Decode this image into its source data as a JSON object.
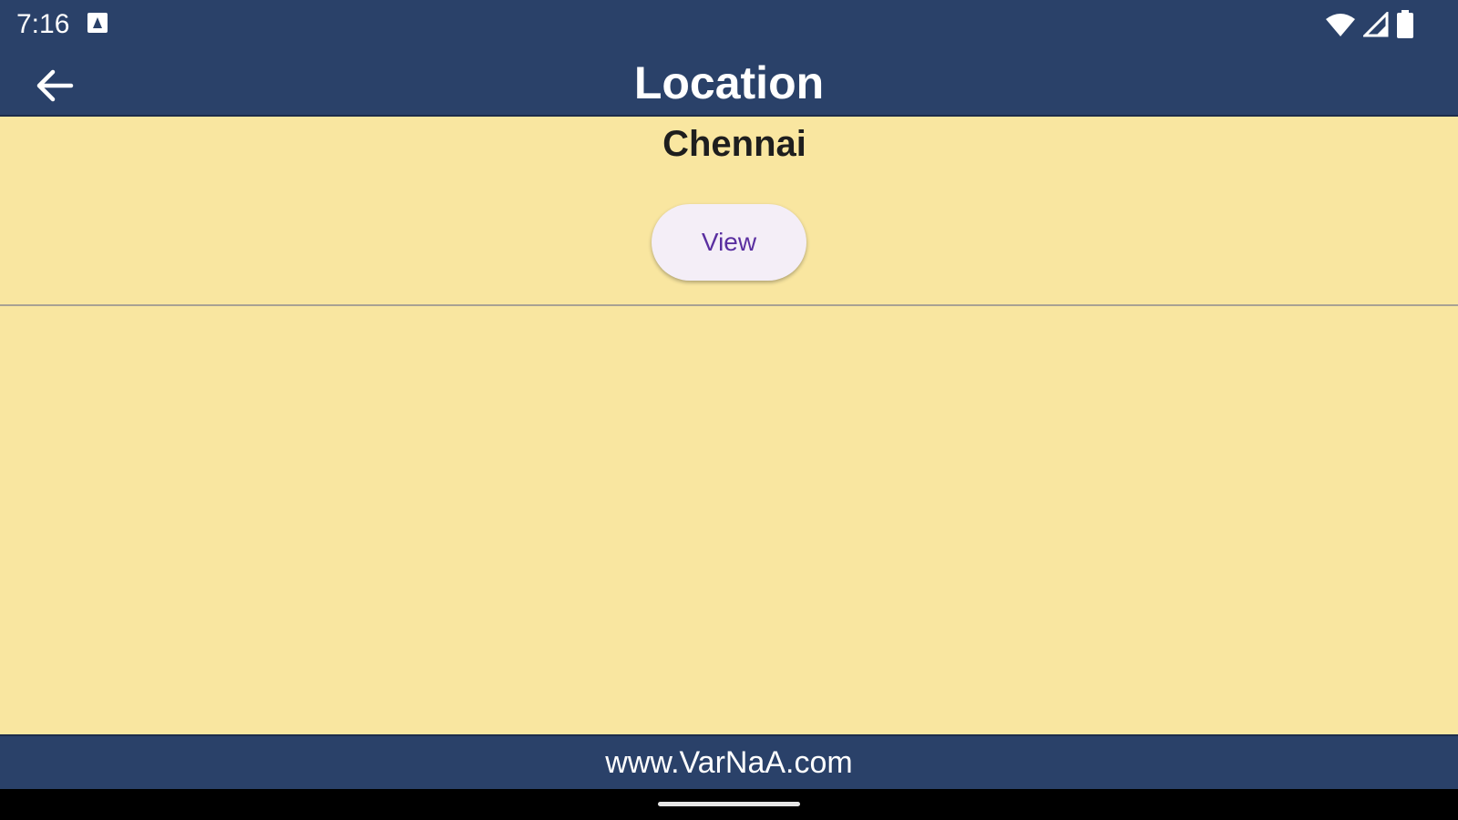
{
  "status_bar": {
    "time": "7:16",
    "icons": [
      "notification-icon",
      "wifi-icon",
      "signal-icon",
      "battery-icon"
    ]
  },
  "app_bar": {
    "title": "Location",
    "back_icon": "arrow-back-icon"
  },
  "content": {
    "city": "Chennai",
    "view_button_label": "View"
  },
  "footer": {
    "link_text": "www.VarNaA.com"
  },
  "colors": {
    "bar_background": "#2A4169",
    "content_background": "#F9E6A0",
    "button_background": "#F4EEF7",
    "button_text": "#5A2FA0"
  }
}
